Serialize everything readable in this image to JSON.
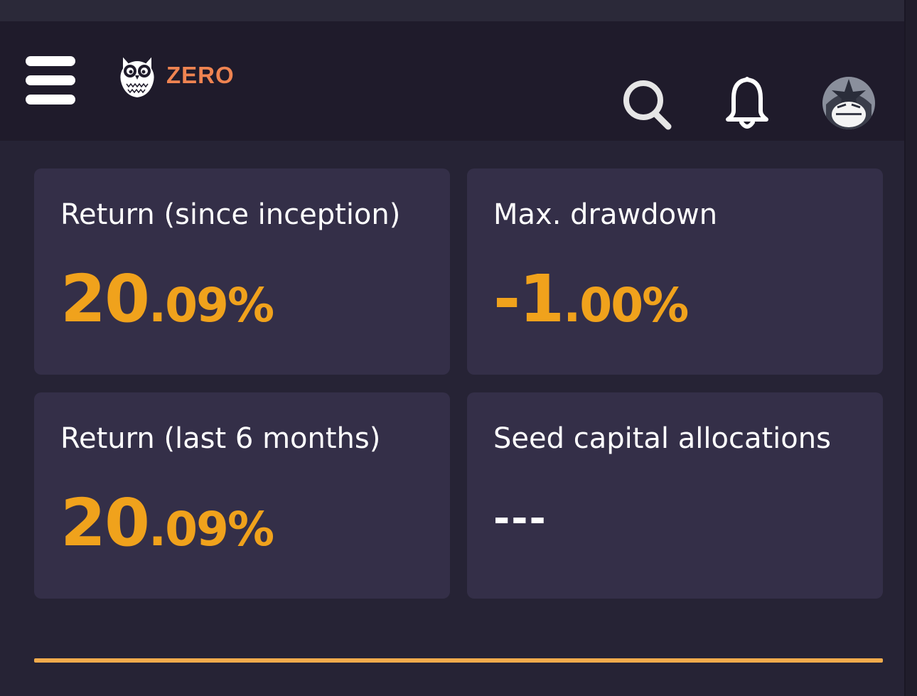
{
  "header": {
    "brand": "ZERO",
    "menu_icon": "hamburger-menu-icon",
    "search_icon": "search-icon",
    "notifications_icon": "bell-icon",
    "avatar_icon": "user-avatar"
  },
  "stats": [
    {
      "title": "Return (since inception)",
      "value_int": "20",
      "value_dec": ".09%"
    },
    {
      "title": "Max. drawdown",
      "value_int": "-1",
      "value_dec": ".00%"
    },
    {
      "title": "Return (last 6 months)",
      "value_int": "20",
      "value_dec": ".09%"
    },
    {
      "title": "Seed capital allocations",
      "value": "---"
    }
  ],
  "colors": {
    "accent": "#f0a21c",
    "brand": "#ef8451",
    "card_bg": "#342f48",
    "header_bg": "#1f1b2b",
    "page_bg": "#262335",
    "divider": "#f2ab4c"
  }
}
